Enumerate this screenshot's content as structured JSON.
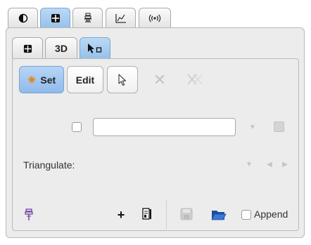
{
  "top_tabs": [
    {
      "icon": "contrast-icon",
      "active": false
    },
    {
      "icon": "grid-icon",
      "active": true
    },
    {
      "icon": "anatomy-icon",
      "active": false
    },
    {
      "icon": "chart-icon",
      "active": false
    },
    {
      "icon": "signal-icon",
      "active": false
    }
  ],
  "sub_tabs": [
    {
      "icon": "grid-icon",
      "label": "",
      "active": false
    },
    {
      "icon": "",
      "label": "3D",
      "active": false
    },
    {
      "icon": "pointer-square-icon",
      "label": "",
      "active": true
    }
  ],
  "toolbar": {
    "set_label": "Set",
    "edit_label": "Edit"
  },
  "triangulate_label": "Triangulate:",
  "append_label": "Append",
  "colors": {
    "accent_blue": "#9dc4ee",
    "panel_bg": "#ececec"
  }
}
